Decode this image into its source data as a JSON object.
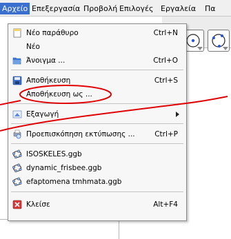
{
  "menubar": {
    "items": [
      {
        "label": "Αρχείο"
      },
      {
        "label": "Επεξεργασία"
      },
      {
        "label": "Προβολή"
      },
      {
        "label": "Επιλογές"
      },
      {
        "label": "Εργαλεία"
      },
      {
        "label": "Πα"
      }
    ]
  },
  "file_menu": {
    "new_window": {
      "label": "Νέο παράθυρο",
      "shortcut": "Ctrl+N"
    },
    "new": {
      "label": "Νέο"
    },
    "open": {
      "label": "Άνοιγμα ...",
      "shortcut": "Ctrl+O"
    },
    "save": {
      "label": "Αποθήκευση",
      "shortcut": "Ctrl+S"
    },
    "save_as": {
      "label": "Αποθήκευση ως ..."
    },
    "export": {
      "label": "Εξαγωγή"
    },
    "print_preview": {
      "label": "Προεπισκόπηση εκτύπωσης ...",
      "shortcut": "Ctrl+P"
    },
    "recent": [
      {
        "label": "ISOSKELES.ggb"
      },
      {
        "label": "dynamic_frisbee.ggb"
      },
      {
        "label": "efaptomena tmhmata.ggb"
      }
    ],
    "close": {
      "label": "Κλείσε",
      "shortcut": "Alt+F4"
    }
  },
  "colors": {
    "menu_highlight": "#3a6fd0",
    "annotation": "#e00000"
  }
}
